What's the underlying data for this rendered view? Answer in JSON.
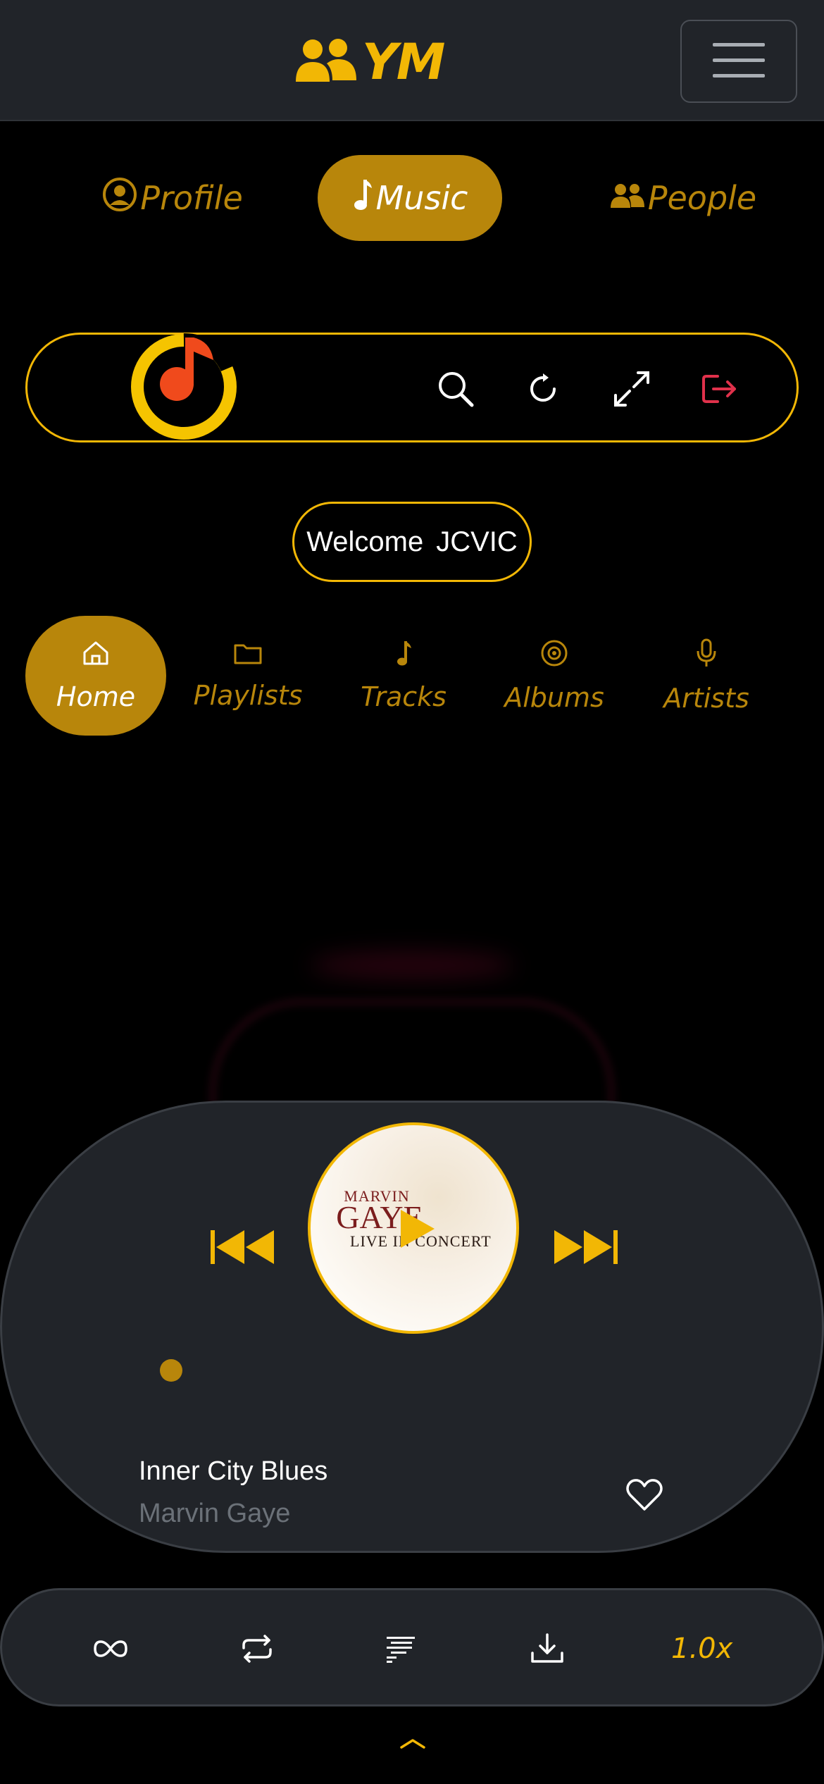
{
  "header": {
    "brand_text": "YM",
    "brand_icon": "people-icon",
    "menu_icon": "hamburger-icon"
  },
  "main_nav": [
    {
      "label": "Profile",
      "icon": "user-circle-icon",
      "active": false
    },
    {
      "label": "Music",
      "icon": "music-note-icon",
      "active": true
    },
    {
      "label": "People",
      "icon": "people-icon",
      "active": false
    }
  ],
  "toolbar": {
    "logo": "ym-music-logo",
    "actions": [
      "search-icon",
      "refresh-icon",
      "expand-icon",
      "logout-icon"
    ]
  },
  "welcome": {
    "greeting": "Welcome",
    "username": "JCVIC"
  },
  "sub_nav": [
    {
      "label": "Home",
      "icon": "home-icon",
      "active": true
    },
    {
      "label": "Playlists",
      "icon": "folder-icon",
      "active": false
    },
    {
      "label": "Tracks",
      "icon": "music-note-icon",
      "active": false
    },
    {
      "label": "Albums",
      "icon": "disc-icon",
      "active": false
    },
    {
      "label": "Artists",
      "icon": "microphone-icon",
      "active": false
    }
  ],
  "player": {
    "album_art": {
      "line1": "MARVIN",
      "line2": "GAYE",
      "line3": "LIVE IN CONCERT"
    },
    "track_title": "Inner City Blues",
    "artist": "Marvin Gaye",
    "progress": 0,
    "liked": false
  },
  "options": {
    "items": [
      "infinite-icon",
      "repeat-icon",
      "queue-icon",
      "download-icon"
    ],
    "speed": "1.0x"
  },
  "colors": {
    "accent": "#f2b705",
    "accent_dark": "#b8860b",
    "surface": "#212429",
    "logout": "#e0314b"
  }
}
